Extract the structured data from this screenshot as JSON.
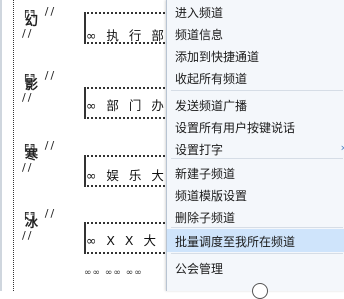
{
  "channels": [
    {
      "glyph": "幻",
      "top": "╒╕ //",
      "bottom": "//  ",
      "label": "∞ 执 行 部 门"
    },
    {
      "glyph": "影",
      "top": "╒╕ //",
      "bottom": "//  ",
      "label": "∞ 部 门 办 公"
    },
    {
      "glyph": "寒",
      "top": "╒╕ //",
      "bottom": "//  ",
      "label": "∞ 娱 乐 大 厅"
    },
    {
      "glyph": "冰",
      "top": "╒╕ //",
      "bottom": "//  ",
      "label": "∞ X X 大 厅"
    }
  ],
  "menu": {
    "items": [
      {
        "label": "进入频道"
      },
      {
        "label": "频道信息"
      },
      {
        "label": "添加到快捷通道"
      },
      {
        "label": "收起所有频道"
      },
      {
        "label": "发送频道广播"
      },
      {
        "label": "设置所有用户按键说话"
      },
      {
        "label": "设置打字"
      },
      {
        "label": "新建子频道"
      },
      {
        "label": "频道模版设置"
      },
      {
        "label": "删除子频道"
      },
      {
        "label": "批量调度至我所在频道"
      },
      {
        "label": "公会管理"
      }
    ],
    "highlight_color": "#cfe4fb",
    "submenu_arrow": "›"
  },
  "bottom_dots": "∞∞ ∞∞ ∞∞"
}
